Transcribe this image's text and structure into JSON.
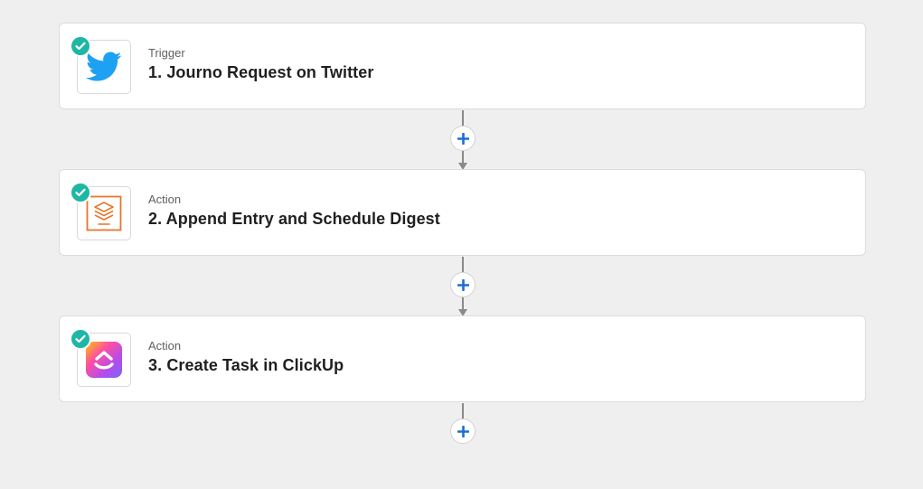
{
  "steps": [
    {
      "type": "Trigger",
      "title": "1. Journo Request on Twitter",
      "app_icon": "twitter-icon",
      "status": "complete"
    },
    {
      "type": "Action",
      "title": "2. Append Entry and Schedule Digest",
      "app_icon": "digest-icon",
      "status": "complete"
    },
    {
      "type": "Action",
      "title": "3. Create Task in ClickUp",
      "app_icon": "clickup-icon",
      "status": "complete"
    }
  ],
  "add_step_icon": "plus-icon",
  "colors": {
    "check": "#1eb7a5",
    "plus": "#1b6ed6",
    "twitter": "#1da1f2",
    "digest": "#e8762c",
    "background": "#efefef"
  }
}
